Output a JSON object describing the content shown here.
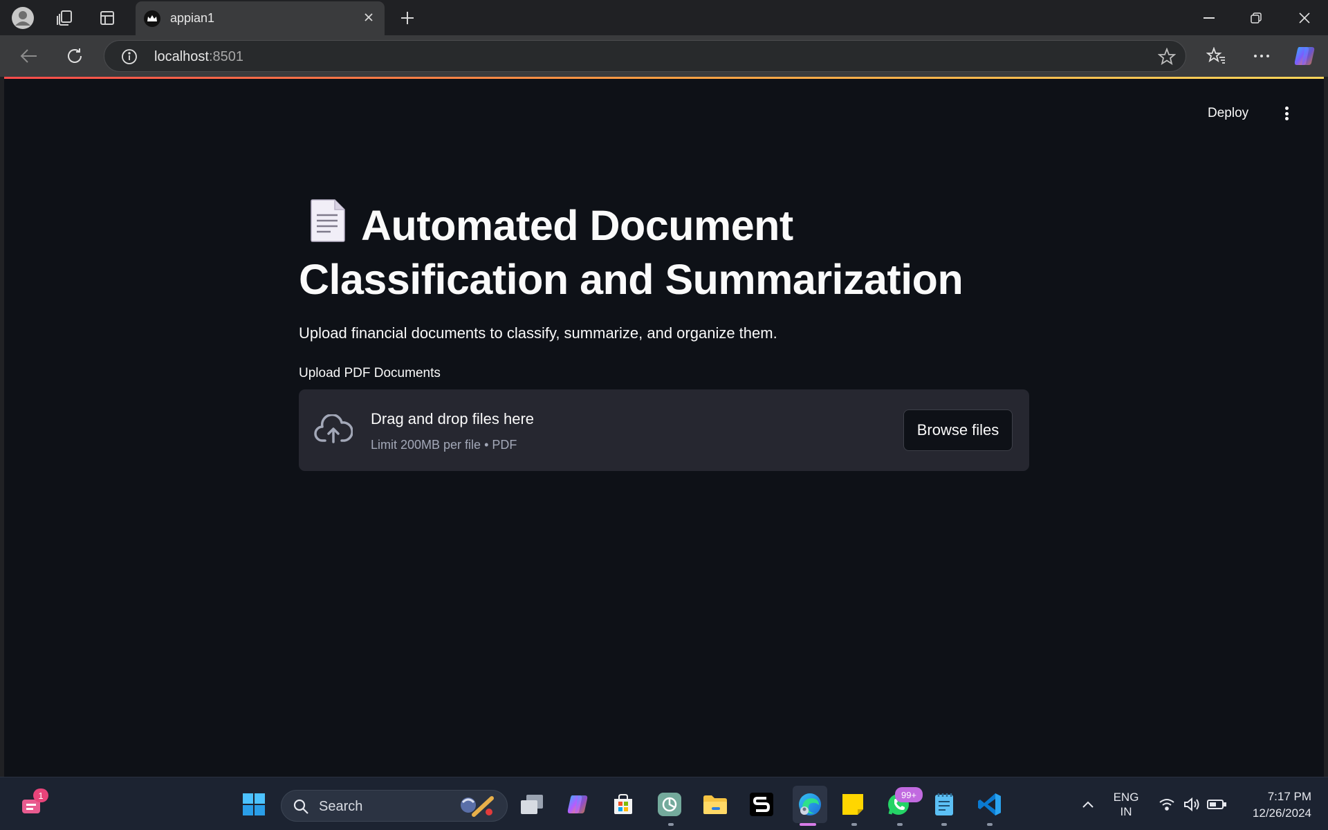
{
  "browser": {
    "tab_title": "appian1",
    "url_host": "localhost",
    "url_port": ":8501"
  },
  "app": {
    "deploy_label": "Deploy",
    "title_line1": "Automated Document",
    "title_line2": "Classification and Summarization",
    "subtitle": "Upload financial documents to classify, summarize, and organize them.",
    "upload_label": "Upload PDF Documents",
    "dropzone_main": "Drag and drop files here",
    "dropzone_sub": "Limit 200MB per file • PDF",
    "browse_label": "Browse files"
  },
  "taskbar": {
    "search_placeholder": "Search",
    "notification_count": "1",
    "whatsapp_badge": "99+",
    "lang_line1": "ENG",
    "lang_line2": "IN",
    "time": "7:17 PM",
    "date": "12/26/2024"
  },
  "colors": {
    "page_bg": "#0e1117",
    "dropzone_bg": "#262730",
    "accent_gradient_start": "#ff4b4b",
    "accent_gradient_end": "#ffd65a"
  }
}
